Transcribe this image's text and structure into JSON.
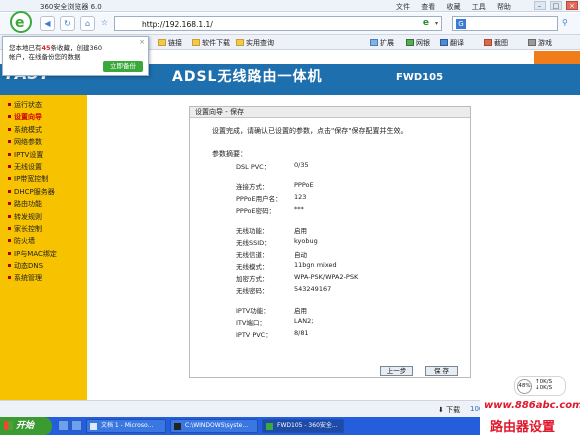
{
  "browser": {
    "title": "360安全浏览器 6.0",
    "menu": [
      "文件",
      "查看",
      "收藏",
      "工具",
      "帮助"
    ],
    "window_buttons": [
      "–",
      "□",
      "×"
    ],
    "address": "http://192.168.1.1/",
    "search_placeholder": "",
    "favorites": [
      "链接",
      "软件下载",
      "实用查询",
      "扩展",
      "网银",
      "翻译",
      "截图",
      "游戏"
    ],
    "popup": {
      "text_pre": "您本地已有",
      "count": "45",
      "text_post": "条收藏，创建360帐户，在线备份您的数据",
      "button": "立即备份",
      "close": "×"
    }
  },
  "router": {
    "title": "ADSL无线路由一体机",
    "model": "FWD105",
    "logo": "FAST",
    "menu": [
      {
        "label": "运行状态",
        "active": false
      },
      {
        "label": "设置向导",
        "active": true
      },
      {
        "label": "系统模式",
        "active": false
      },
      {
        "label": "网络参数",
        "active": false
      },
      {
        "label": "IPTV设置",
        "active": false
      },
      {
        "label": "无线设置",
        "active": false
      },
      {
        "label": "IP带宽控制",
        "active": false
      },
      {
        "label": "DHCP服务器",
        "active": false
      },
      {
        "label": "路由功能",
        "active": false
      },
      {
        "label": "转发规则",
        "active": false
      },
      {
        "label": "家长控制",
        "active": false
      },
      {
        "label": "防火墙",
        "active": false
      },
      {
        "label": "IP与MAC绑定",
        "active": false
      },
      {
        "label": "动态DNS",
        "active": false
      },
      {
        "label": "系统管理",
        "active": false
      }
    ],
    "panel": {
      "header": "设置向导 - 保存",
      "intro": "设置完成，请确认已设置的参数，点击\"保存\"保存配置并生效。",
      "summary_label": "参数摘要：",
      "rows": [
        {
          "label": "DSL PVC：",
          "value": "0/35"
        },
        {
          "label": "连接方式：",
          "value": "PPPoE"
        },
        {
          "label": "PPPoE用户名：",
          "value": "123"
        },
        {
          "label": "PPPoE密码：",
          "value": "***"
        },
        {
          "label": "无线功能：",
          "value": "启用"
        },
        {
          "label": "无线SSID：",
          "value": "kyobug"
        },
        {
          "label": "无线信道：",
          "value": "自动"
        },
        {
          "label": "无线模式：",
          "value": "11bgn mixed"
        },
        {
          "label": "加密方式：",
          "value": "WPA-PSK/WPA2-PSK"
        },
        {
          "label": "无线密码：",
          "value": "543249167"
        },
        {
          "label": "IPTV功能：",
          "value": "启用"
        },
        {
          "label": "ITV端口：",
          "value": "LAN2;"
        },
        {
          "label": "IPTV PVC：",
          "value": "8/81"
        }
      ],
      "prev_button": "上一步",
      "save_button": "保 存"
    }
  },
  "tray_widget": {
    "percent": "48%",
    "up": "0K/S",
    "down": "0K/S"
  },
  "statusbar": {
    "download": "下载",
    "zoom": "100%"
  },
  "taskbar": {
    "start": "开始",
    "tasks": [
      "文档 1 - Microso...",
      "C:\\WINDOWS\\syste...",
      "FWD105 - 360安全..."
    ]
  },
  "watermark": {
    "url": "www.886abc.com",
    "text": "路由器设置"
  }
}
